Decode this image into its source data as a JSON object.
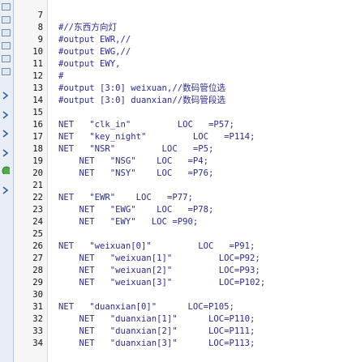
{
  "editor": {
    "theme": {
      "keyword_color": "#2b2b8f",
      "string_color": "#7a4f4f",
      "line_number_color": "#111111",
      "background": "#ffffff"
    },
    "lines": [
      {
        "number": "7",
        "text": "#//东西方向灯"
      },
      {
        "number": "8",
        "text": "#output EWR,//"
      },
      {
        "number": "9",
        "text": "#output EWG,//"
      },
      {
        "number": "10",
        "text": "#output EWY,"
      },
      {
        "number": "11",
        "text": "#"
      },
      {
        "number": "12",
        "text": "#output [3:0] weixuan,//数码管位选"
      },
      {
        "number": "13",
        "text": "#output [3:0] duanxian//数码管段选"
      },
      {
        "number": "14",
        "text": ""
      },
      {
        "number": "15",
        "text": "NET   \"clk_in\"         LOC   =P57;"
      },
      {
        "number": "16",
        "text": "NET   \"key_night\"         LOC   =P114;"
      },
      {
        "number": "17",
        "text": "NET   \"NSR\"         LOC   =P5;"
      },
      {
        "number": "18",
        "text": "    NET   \"NSG\"    LOC   =P4;"
      },
      {
        "number": "19",
        "text": "    NET   \"NSY\"    LOC   =P76;"
      },
      {
        "number": "20",
        "text": ""
      },
      {
        "number": "21",
        "text": "NET   \"EWR\"    LOC   =P77;"
      },
      {
        "number": "22",
        "text": "    NET   \"EWG\"    LOC   =P78;"
      },
      {
        "number": "23",
        "text": "    NET   \"EWY\"   LOC =P90;"
      },
      {
        "number": "24",
        "text": ""
      },
      {
        "number": "25",
        "text": "NET   \"weixuan[0]\"         LOC   =P91;"
      },
      {
        "number": "26",
        "text": "    NET   \"weixuan[1]\"         LOC=P92;"
      },
      {
        "number": "27",
        "text": "    NET   \"weixuan[2]\"         LOC=P93;"
      },
      {
        "number": "28",
        "text": "    NET   \"weixuan[3]\"         LOC=P102;"
      },
      {
        "number": "29",
        "text": ""
      },
      {
        "number": "30",
        "text": "NET   \"duanxian[0]\"      LOC=P105;"
      },
      {
        "number": "31",
        "text": "    NET   \"duanxian[1]\"      LOC=P110;"
      },
      {
        "number": "32",
        "text": "    NET   \"duanxian[2]\"      LOC=P111;"
      },
      {
        "number": "33",
        "text": "    NET   \"duanxian[3]\"      LOC=P113;"
      },
      {
        "number": "34",
        "text": ""
      }
    ]
  },
  "left_strip": {
    "items": [
      {
        "icon": "expand-arrow-icon"
      },
      {
        "icon": "document-icon"
      },
      {
        "icon": "document-icon"
      },
      {
        "icon": "document-icon"
      },
      {
        "icon": "document-icon"
      },
      {
        "icon": "status-green-icon"
      },
      {
        "icon": "document-icon"
      }
    ]
  }
}
